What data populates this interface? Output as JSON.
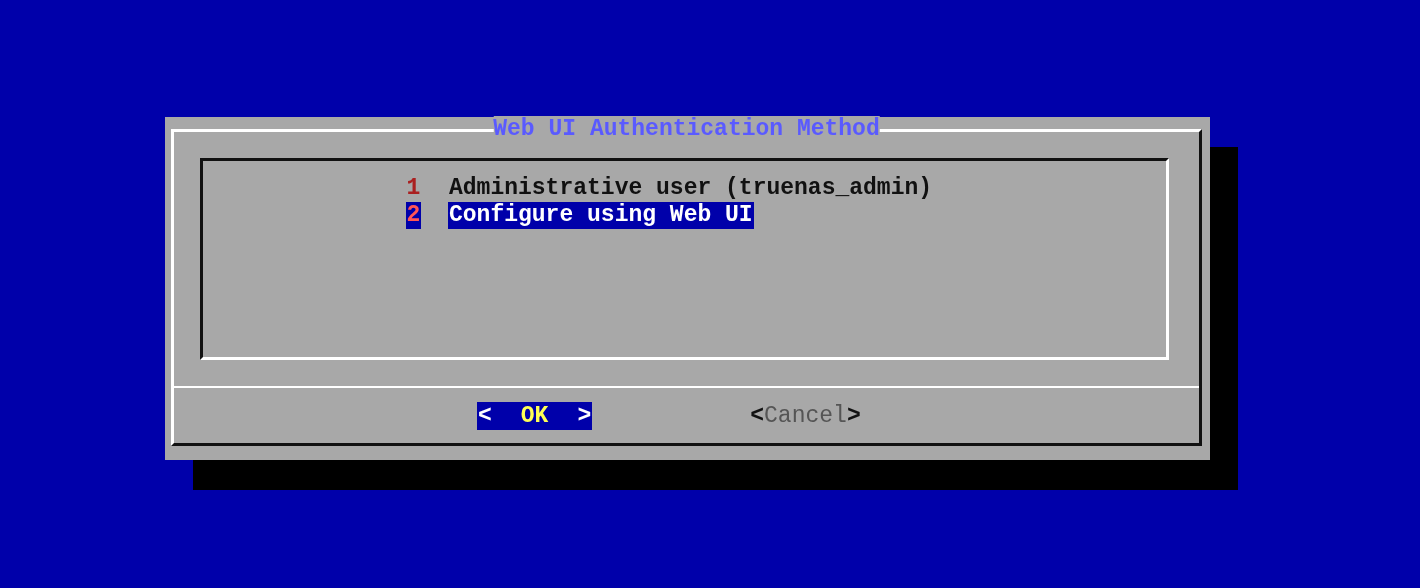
{
  "dialog": {
    "title": "Web UI Authentication Method",
    "menu": [
      {
        "tag": "1",
        "label": "Administrative user (truenas_admin)",
        "selected": false
      },
      {
        "tag": "2",
        "label": "Configure using Web UI",
        "selected": true
      }
    ],
    "buttons": [
      {
        "open": "<",
        "label": "OK",
        "close": ">",
        "selected": true
      },
      {
        "open": "<",
        "label": "Cancel",
        "close": ">",
        "selected": false
      }
    ]
  }
}
